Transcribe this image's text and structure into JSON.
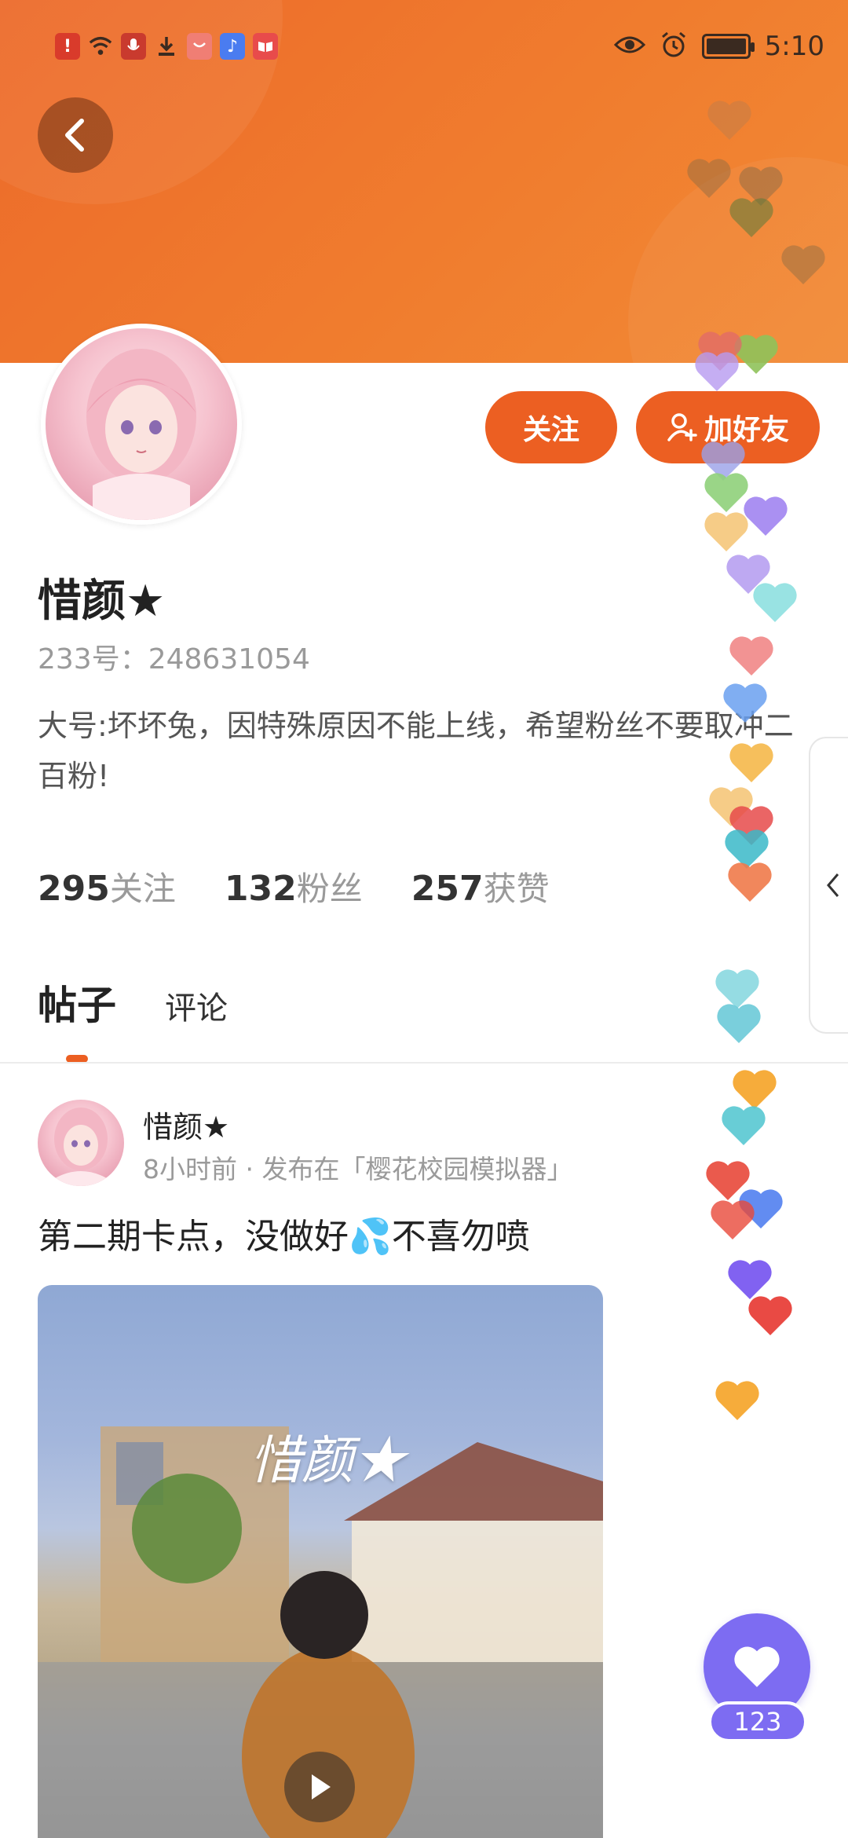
{
  "status_bar": {
    "time": "5:10",
    "left_icons": [
      {
        "name": "alert-icon",
        "glyph": "!",
        "color": "#d93b2b"
      },
      {
        "name": "wifi-icon",
        "glyph": "",
        "color": ""
      },
      {
        "name": "mic-icon",
        "glyph": "",
        "color": "#c93a2e"
      },
      {
        "name": "download-icon",
        "glyph": "",
        "color": ""
      },
      {
        "name": "shop-icon",
        "glyph": "",
        "color": "#f07e74"
      },
      {
        "name": "music-icon",
        "glyph": "♪",
        "color": "#4a7cf0"
      },
      {
        "name": "book-icon",
        "glyph": "",
        "color": "#e84b4b"
      }
    ]
  },
  "profile": {
    "name": "惜颜★",
    "id_label": "233号：",
    "id_value": "248631054",
    "bio": "大号:坏坏兔，因特殊原因不能上线，希望粉丝不要取冲二百粉!",
    "follow_label": "关注",
    "add_friend_label": "加好友"
  },
  "stats": [
    {
      "num": "295",
      "label": "关注"
    },
    {
      "num": "132",
      "label": "粉丝"
    },
    {
      "num": "257",
      "label": "获赞"
    }
  ],
  "tabs": [
    {
      "label": "帖子",
      "active": true
    },
    {
      "label": "评论",
      "active": false
    }
  ],
  "post": {
    "author": "惜颜★",
    "time": "8小时前",
    "published_in": "发布在「樱花校园模拟器」",
    "text": "第二期卡点，没做好💦不喜勿喷",
    "video_watermark": "惜颜★"
  },
  "likes": {
    "count": "123"
  },
  "colors": {
    "header_orange": "#ec6a2a",
    "accent": "#ec5f22",
    "fab_purple": "#7d6cf2"
  }
}
